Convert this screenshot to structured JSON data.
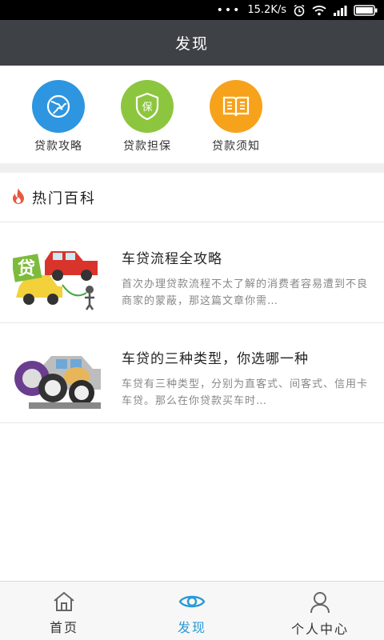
{
  "status_bar": {
    "speed": "15.2K/s",
    "dots": "•••"
  },
  "header": {
    "title": "发现"
  },
  "quick_menu": [
    {
      "label": "贷款攻略",
      "icon": "globe-icon",
      "color": "#2e96e0"
    },
    {
      "label": "贷款担保",
      "icon": "shield-icon",
      "color": "#8cc63f",
      "glyph": "保"
    },
    {
      "label": "贷款须知",
      "icon": "book-icon",
      "color": "#f7a21b"
    }
  ],
  "section": {
    "title": "热门百科",
    "icon": "flame-icon",
    "icon_color": "#e9573f"
  },
  "articles": [
    {
      "title": "车贷流程全攻略",
      "desc": "首次办理贷款流程不太了解的消费者容易遭到不良商家的蒙蔽，那这篇文章你需…",
      "thumb_text": "贷"
    },
    {
      "title": "车贷的三种类型，你选哪一种",
      "desc": "车贷有三种类型，分别为直客式、间客式、信用卡车贷。那么在你贷款买车时…",
      "thumb_text": ""
    }
  ],
  "bottom_nav": [
    {
      "label": "首页",
      "icon": "home-icon",
      "active": false
    },
    {
      "label": "发现",
      "icon": "eye-icon",
      "active": true
    },
    {
      "label": "个人中心",
      "icon": "user-icon",
      "active": false
    }
  ],
  "colors": {
    "accent": "#2a9ad6",
    "header_bg": "#3e4247"
  }
}
